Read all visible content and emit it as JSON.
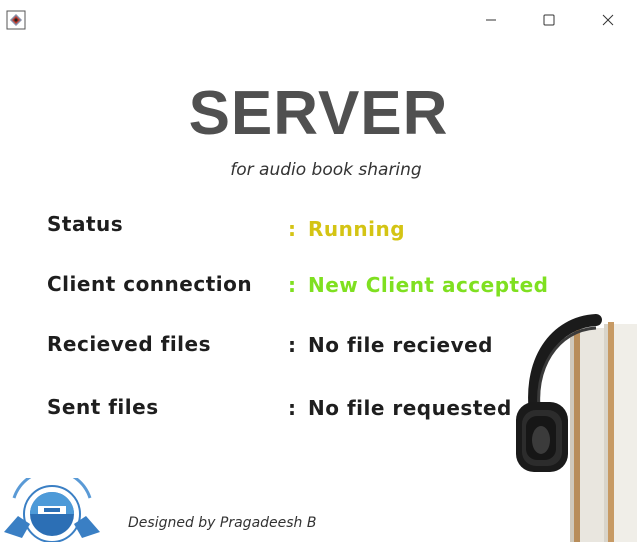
{
  "window": {
    "controls": {
      "minimize_icon": "minimize-icon",
      "maximize_icon": "maximize-icon",
      "close_icon": "close-icon"
    }
  },
  "header": {
    "title": "SERVER",
    "subtitle": "for audio book sharing"
  },
  "status_rows": [
    {
      "label": "Status",
      "separator": ":",
      "value": "Running",
      "value_color": "#d4c414"
    },
    {
      "label": "Client connection",
      "separator": ":",
      "value": "New Client accepted",
      "value_color": "#7fe020"
    },
    {
      "label": "Recieved files",
      "separator": ":",
      "value": "No file recieved",
      "value_color": "#1e1e1e"
    },
    {
      "label": "Sent files",
      "separator": ":",
      "value": "No file requested",
      "value_color": "#1e1e1e"
    }
  ],
  "footer": {
    "credit": "Designed by Pragadeesh B"
  },
  "colors": {
    "title": "#505050",
    "label": "#1e1e1e",
    "running": "#d4c414",
    "accepted": "#7fe020"
  }
}
